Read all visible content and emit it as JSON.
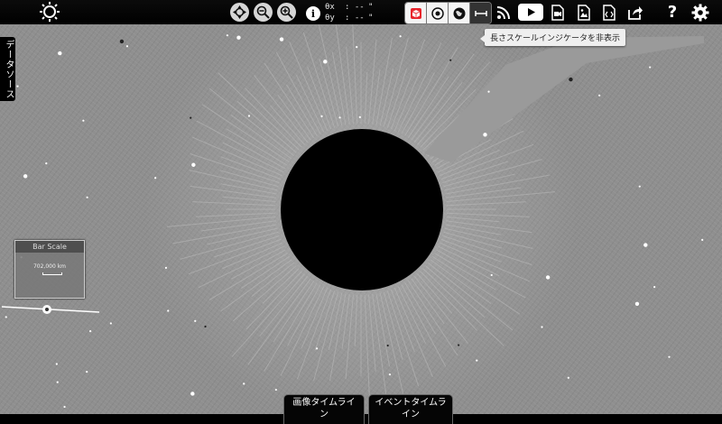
{
  "viewer": {
    "title": ""
  },
  "coords": {
    "x_label": "θx",
    "x_value": ": --",
    "x_unit": "\"",
    "y_label": "θy",
    "y_value": ": --",
    "y_unit": "\""
  },
  "toolbar_icons": {
    "brightness": "sun-gear-icon",
    "center": "crosshair-icon",
    "zoom_out": "zoom-out-icon",
    "zoom_in": "zoom-in-icon",
    "info": "info-icon",
    "info_glyph": "i",
    "layer_buttons": [
      "cube-icon",
      "target-icon",
      "globe-icon",
      "length-scale-icon"
    ],
    "right": [
      "rss-icon",
      "youtube-icon",
      "movie-file-icon",
      "image-file-icon",
      "embed-code-icon",
      "share-icon",
      "help-icon",
      "settings-icon"
    ],
    "help_glyph": "?"
  },
  "tooltip": {
    "text": "長さスケールインジケータを非表示"
  },
  "sidebar": {
    "data_source_label": "データソース"
  },
  "bar_scale": {
    "title": "Bar Scale",
    "value": "702,000 km"
  },
  "timeline_tabs": {
    "image_timeline_line1": "画像タイムライ",
    "image_timeline_line2": "ン",
    "event_timeline_line1": "イベントタイムラ",
    "event_timeline_line2": "イン"
  },
  "colors": {
    "background": "#8f8f8f",
    "toolbar": "#000000",
    "active_layer_button": "#e8232b",
    "youtube_button": "#ffffff"
  }
}
